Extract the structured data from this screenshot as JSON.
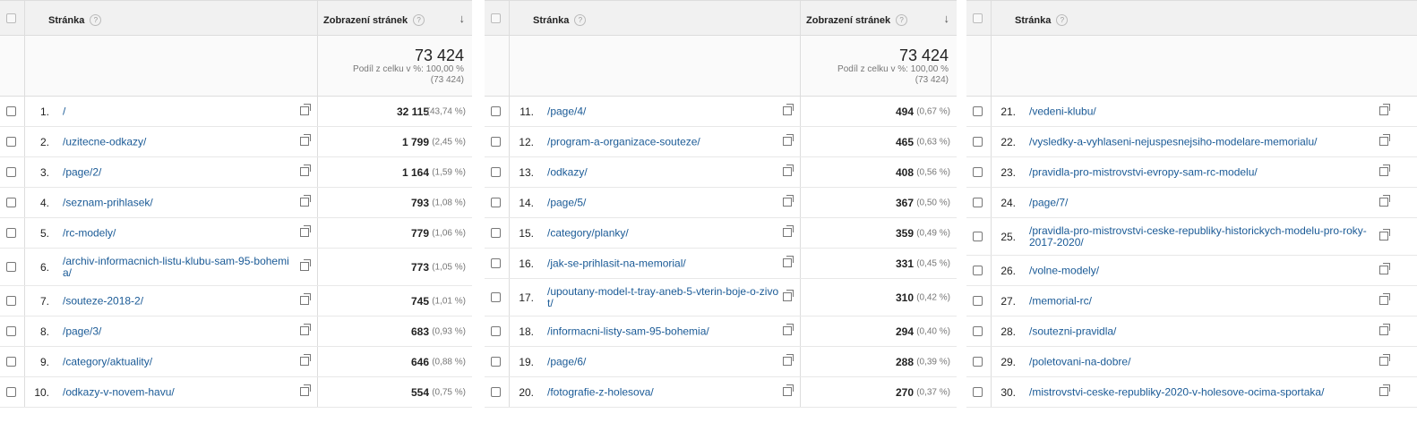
{
  "columns": {
    "page": "Stránka",
    "views": "Zobrazení stránek",
    "help": "?",
    "sort_arrow": "↓"
  },
  "totals": {
    "value": "73 424",
    "share": "Podíl z celku v %: 100,00 %",
    "share_abs": "(73 424)"
  },
  "panels": [
    {
      "show_views": true,
      "rows": [
        {
          "n": "1.",
          "page": "/",
          "views": "32 115",
          "pct": "(43,74 %)"
        },
        {
          "n": "2.",
          "page": "/uzitecne-odkazy/",
          "views": "1 799",
          "pct": "(2,45 %)"
        },
        {
          "n": "3.",
          "page": "/page/2/",
          "views": "1 164",
          "pct": "(1,59 %)"
        },
        {
          "n": "4.",
          "page": "/seznam-prihlasek/",
          "views": "793",
          "pct": "(1,08 %)"
        },
        {
          "n": "5.",
          "page": "/rc-modely/",
          "views": "779",
          "pct": "(1,06 %)"
        },
        {
          "n": "6.",
          "page": "/archiv-informacnich-listu-klubu-sam-95-bohemia/",
          "views": "773",
          "pct": "(1,05 %)"
        },
        {
          "n": "7.",
          "page": "/souteze-2018-2/",
          "views": "745",
          "pct": "(1,01 %)"
        },
        {
          "n": "8.",
          "page": "/page/3/",
          "views": "683",
          "pct": "(0,93 %)"
        },
        {
          "n": "9.",
          "page": "/category/aktuality/",
          "views": "646",
          "pct": "(0,88 %)"
        },
        {
          "n": "10.",
          "page": "/odkazy-v-novem-havu/",
          "views": "554",
          "pct": "(0,75 %)"
        }
      ]
    },
    {
      "show_views": true,
      "rows": [
        {
          "n": "11.",
          "page": "/page/4/",
          "views": "494",
          "pct": "(0,67 %)"
        },
        {
          "n": "12.",
          "page": "/program-a-organizace-souteze/",
          "views": "465",
          "pct": "(0,63 %)"
        },
        {
          "n": "13.",
          "page": "/odkazy/",
          "views": "408",
          "pct": "(0,56 %)"
        },
        {
          "n": "14.",
          "page": "/page/5/",
          "views": "367",
          "pct": "(0,50 %)"
        },
        {
          "n": "15.",
          "page": "/category/planky/",
          "views": "359",
          "pct": "(0,49 %)"
        },
        {
          "n": "16.",
          "page": "/jak-se-prihlasit-na-memorial/",
          "views": "331",
          "pct": "(0,45 %)"
        },
        {
          "n": "17.",
          "page": "/upoutany-model-t-tray-aneb-5-vterin-boje-o-zivot/",
          "views": "310",
          "pct": "(0,42 %)"
        },
        {
          "n": "18.",
          "page": "/informacni-listy-sam-95-bohemia/",
          "views": "294",
          "pct": "(0,40 %)"
        },
        {
          "n": "19.",
          "page": "/page/6/",
          "views": "288",
          "pct": "(0,39 %)"
        },
        {
          "n": "20.",
          "page": "/fotografie-z-holesova/",
          "views": "270",
          "pct": "(0,37 %)"
        }
      ]
    },
    {
      "show_views": false,
      "rows": [
        {
          "n": "21.",
          "page": "/vedeni-klubu/"
        },
        {
          "n": "22.",
          "page": "/vysledky-a-vyhlaseni-nejuspesnejsiho-modelare-memorialu/"
        },
        {
          "n": "23.",
          "page": "/pravidla-pro-mistrovstvi-evropy-sam-rc-modelu/"
        },
        {
          "n": "24.",
          "page": "/page/7/"
        },
        {
          "n": "25.",
          "page": "/pravidla-pro-mistrovstvi-ceske-republiky-historickych-modelu-pro-roky-2017-2020/"
        },
        {
          "n": "26.",
          "page": "/volne-modely/"
        },
        {
          "n": "27.",
          "page": "/memorial-rc/"
        },
        {
          "n": "28.",
          "page": "/soutezni-pravidla/"
        },
        {
          "n": "29.",
          "page": "/poletovani-na-dobre/"
        },
        {
          "n": "30.",
          "page": "/mistrovstvi-ceske-republiky-2020-v-holesove-ocima-sportaka/"
        }
      ]
    }
  ]
}
